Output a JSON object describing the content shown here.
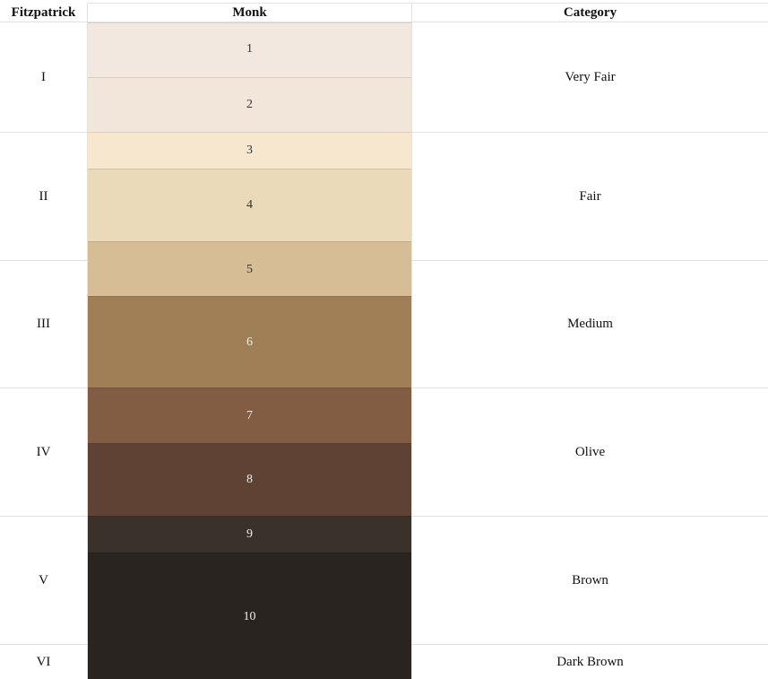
{
  "headers": {
    "fitzpatrick": "Fitzpatrick",
    "monk": "Monk",
    "category": "Category"
  },
  "fitzpatrick_rows": [
    {
      "type": "I",
      "category": "Very Fair"
    },
    {
      "type": "II",
      "category": "Fair"
    },
    {
      "type": "III",
      "category": "Medium"
    },
    {
      "type": "IV",
      "category": "Olive"
    },
    {
      "type": "V",
      "category": "Brown"
    },
    {
      "type": "VI",
      "category": "Dark Brown"
    }
  ],
  "monk_tones": [
    {
      "label": "1",
      "color": "#f2e8df",
      "text_color": "#333333"
    },
    {
      "label": "2",
      "color": "#f2e5da",
      "text_color": "#333333"
    },
    {
      "label": "3",
      "color": "#f8e7cf",
      "text_color": "#333333"
    },
    {
      "label": "4",
      "color": "#eadab9",
      "text_color": "#333333"
    },
    {
      "label": "5",
      "color": "#d7bd96",
      "text_color": "#333333"
    },
    {
      "label": "6",
      "color": "#a07f56",
      "text_color": "#f2ece4"
    },
    {
      "label": "7",
      "color": "#825c43",
      "text_color": "#f2ece4"
    },
    {
      "label": "8",
      "color": "#604234",
      "text_color": "#f2ece4"
    },
    {
      "label": "9",
      "color": "#3a312b",
      "text_color": "#f2ece4"
    },
    {
      "label": "10",
      "color": "#292420",
      "text_color": "#f2ece4"
    }
  ]
}
